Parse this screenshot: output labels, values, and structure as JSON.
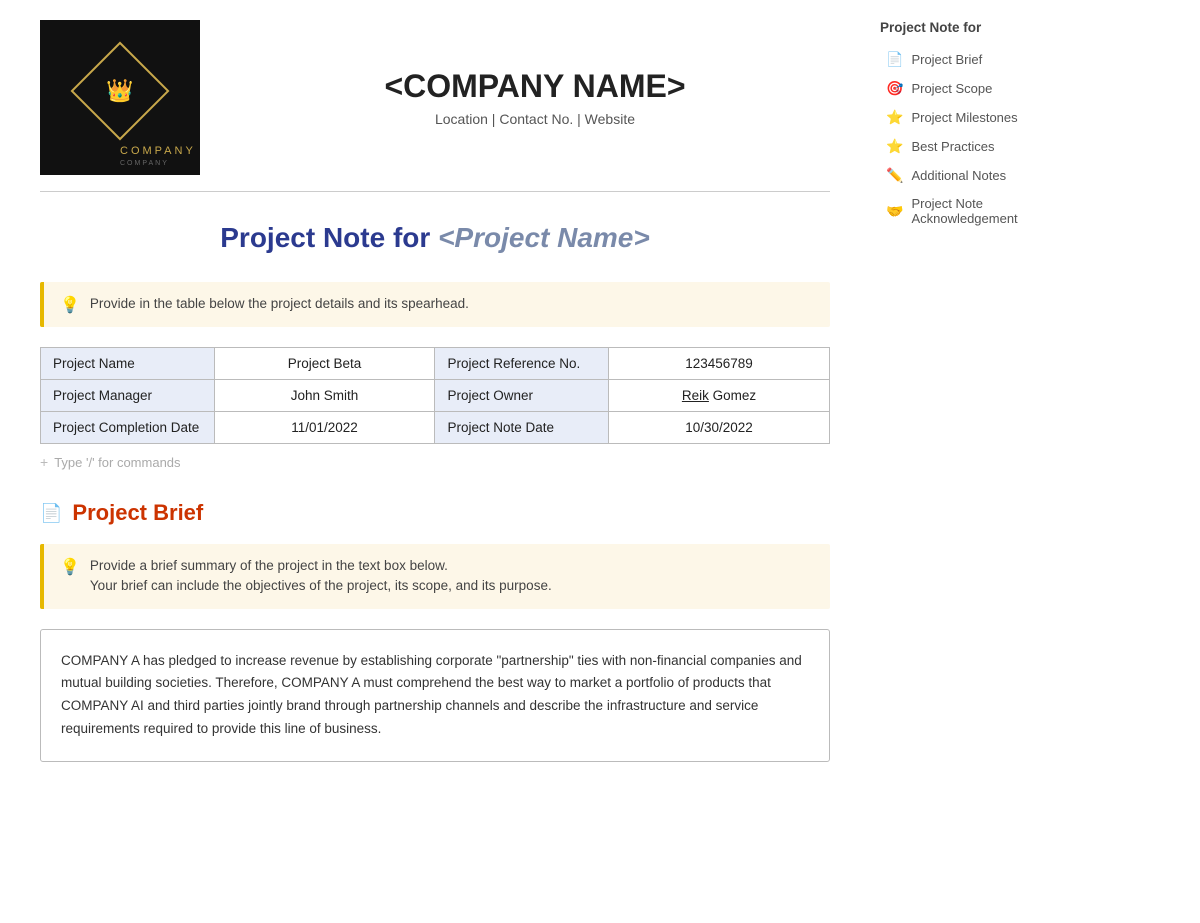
{
  "header": {
    "company_name": "<COMPANY NAME>",
    "company_contact": "Location | Contact No. | Website",
    "logo_text": "COMPANY",
    "logo_sub": "COMPANY"
  },
  "page_title": {
    "prefix": "Project Note for",
    "project_name": "<Project Name>"
  },
  "hint1": {
    "text": "Provide in the table below the project details and its spearhead."
  },
  "project_table": {
    "rows": [
      [
        "Project Name",
        "Project Beta",
        "Project Reference No.",
        "123456789"
      ],
      [
        "Project Manager",
        "John Smith",
        "Project Owner",
        "Reik Gomez"
      ],
      [
        "Project Completion Date",
        "11/01/2022",
        "Project Note Date",
        "10/30/2022"
      ]
    ]
  },
  "add_command": {
    "placeholder": "Type '/' for commands"
  },
  "sections": {
    "project_brief": {
      "label": "Project Brief",
      "icon": "📄",
      "hint_line1": "Provide a brief summary of the project in the text box below.",
      "hint_line2": "Your brief can include the objectives of the project, its scope, and its purpose.",
      "content": "COMPANY A has pledged to increase revenue by establishing corporate \"partnership\" ties with non-financial companies and mutual building societies. Therefore, COMPANY A must comprehend the best way to market a portfolio of products that COMPANY AI and third parties jointly brand through partnership channels and describe the infrastructure and service requirements required to provide this line of business."
    }
  },
  "sidebar": {
    "heading": "Project Note for",
    "items": [
      {
        "label": "Project Brief",
        "icon": "📄"
      },
      {
        "label": "Project Scope",
        "icon": "🎯"
      },
      {
        "label": "Project Milestones",
        "icon": "⭐"
      },
      {
        "label": "Best Practices",
        "icon": "⭐"
      },
      {
        "label": "Additional Notes",
        "icon": "✏️"
      },
      {
        "label": "Project Note Acknowledgement",
        "icon": "🤝"
      }
    ]
  }
}
